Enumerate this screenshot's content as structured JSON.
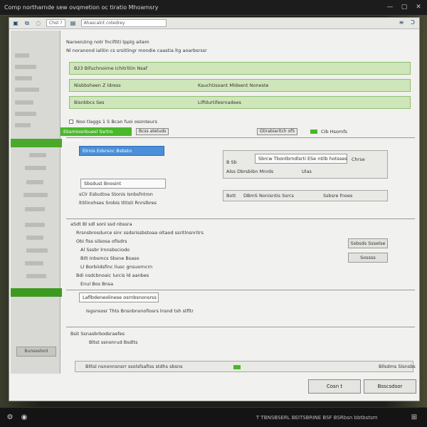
{
  "window": {
    "title": "Comp northarnde sew ovqmetion oc tiratio Mhoamsry",
    "ctrl_min": "—",
    "ctrl_max": "▢",
    "ctrl_close": "✕"
  },
  "toolbar": {
    "address": "Chst  ?",
    "path": "Ahascalnt cotedrey",
    "end_label": "Ɔ"
  },
  "header": {
    "line1": "Naroenzing notr fncifitti tpplg aitem",
    "line2": "Nl noranond ialitin cs srsitlingr mondie caastia ltg aoarbsrssr"
  },
  "green_rows": [
    {
      "col1": "B23 Bifuchnoirne ichitrlitin Nsaf",
      "col2": ""
    },
    {
      "col1": "Nisbbsheen Z ldress",
      "col2": "Kauchtisoant Mldeent Noneste"
    },
    {
      "col1": "Bisnbbcs Ses",
      "col2": "Liffdurtifesrnadees"
    }
  ],
  "section1": {
    "check_line": "Noo  tlaggs  1 S  Bcan fuoi osonteurs",
    "highlight": "Eksmiosnbuesl Ssrtro Sbsensr",
    "chip_a": "Bcss atetuds",
    "chip_b": "Gtirabiaritch ofS",
    "chip_c": "CIb Hsomfs"
  },
  "section2": {
    "blue_field": "Elrnis Edsrsnc Bsbsto",
    "right_input": "Sbrcw Tbonlbrndlsrti ESe ntilb hotsses",
    "right_btn": "Chrse",
    "right_label1": "B Sb",
    "right_label2": "Alss Dbrsbibn Mnrds",
    "right_label3": "Ulas",
    "left_input": "Sbsdust Bnosint",
    "line_a": "sClr Esbuttoa Stonis Isnbsfntron",
    "line_b": "ltitlinxhses  Srobis tlttsti Rnrslbres",
    "bar_c1": "Bott",
    "bar_c2": "DBmS Nonisntis Ssrcs",
    "bar_c3": "Ssbsre fnoes"
  },
  "section3": {
    "l1": "aSdt  Bl sdl sonl ssd nbssra",
    "l2": "Rrsnsbrosdurce sinr ssdsrissbstoaa oltaod ssritlnsnritrs",
    "l3": "Obi fiss silsosa ofisdrs",
    "l4": "Al  Sssbr lrnnsbsciodo",
    "l5": "Bilt Inbsmcs Sbsne Bsaso",
    "l6": "Ll Borbiidsfinc liusc gnsuorncrn",
    "l7": "Bdi nsdcbnoaic lurcis ld aanbes",
    "l8": "Enul Bos Bnsa",
    "btn1": "Ssbsds Ssselse",
    "btn2": "Sossss"
  },
  "section4": {
    "input": "Laflbdeneolinese osrnbsnonsrss",
    "line": "Isgsnsosr Thts Bnsnbnsnofiosrs lnsnd tsh stfltr"
  },
  "section5": {
    "l1": "Bsit Ssnasbrbodsraefes",
    "l2": "Bltst ssnonrud Bsdlts",
    "status": "Blltsl nsnonnsnsrr ssolsfsafiss stdhs  sbsns",
    "status_right": "Bllsdms Slsnsbs"
  },
  "sidebar": {
    "bottom_btn": "Bunsestonl"
  },
  "footer": {
    "cancel": "Cosn t",
    "primary": "Bsscsdsor"
  },
  "taskbar": {
    "text": "Ƭ ƬBNSBSERL BEITSBRINE BSF BSRbsn bbtbstsm"
  }
}
